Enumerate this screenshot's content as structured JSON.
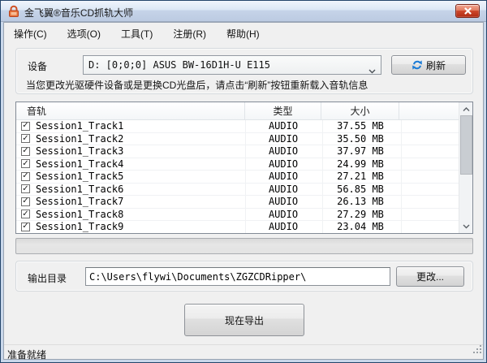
{
  "window": {
    "title": "金飞翼®音乐CD抓轨大师",
    "status_text": "准备就绪"
  },
  "menu": {
    "items": [
      "操作(C)",
      "选项(O)",
      "工具(T)",
      "注册(R)",
      "帮助(H)"
    ]
  },
  "device": {
    "label": "设备",
    "selected": "D:  [0;0;0] ASUS BW-16D1H-U E115",
    "refresh_label": "刷新",
    "hint": "当您更改光驱硬件设备或是更换CD光盘后，请点击“刷新”按钮重新载入音轨信息"
  },
  "tracks": {
    "columns": [
      "音轨",
      "类型",
      "大小"
    ],
    "rows": [
      {
        "checked": true,
        "name": "Session1_Track1",
        "type": "AUDIO",
        "size": "37.55 MB"
      },
      {
        "checked": true,
        "name": "Session1_Track2",
        "type": "AUDIO",
        "size": "35.50 MB"
      },
      {
        "checked": true,
        "name": "Session1_Track3",
        "type": "AUDIO",
        "size": "37.97 MB"
      },
      {
        "checked": true,
        "name": "Session1_Track4",
        "type": "AUDIO",
        "size": "24.99 MB"
      },
      {
        "checked": true,
        "name": "Session1_Track5",
        "type": "AUDIO",
        "size": "27.21 MB"
      },
      {
        "checked": true,
        "name": "Session1_Track6",
        "type": "AUDIO",
        "size": "56.85 MB"
      },
      {
        "checked": true,
        "name": "Session1_Track7",
        "type": "AUDIO",
        "size": "26.13 MB"
      },
      {
        "checked": true,
        "name": "Session1_Track8",
        "type": "AUDIO",
        "size": "27.29 MB"
      },
      {
        "checked": true,
        "name": "Session1_Track9",
        "type": "AUDIO",
        "size": "23.04 MB"
      }
    ]
  },
  "output": {
    "label": "输出目录",
    "path": "C:\\Users\\flywi\\Documents\\ZGZCDRipper\\",
    "change_label": "更改..."
  },
  "export_button": {
    "label": "现在导出"
  },
  "icons": {
    "check": "✓",
    "app_icon": "orange-lock",
    "refresh_icon": "blue-circular-arrows",
    "close_icon": "white-x"
  },
  "colors": {
    "frame_blue": "#24456b",
    "titlebar_top": "#f0f5fc",
    "titlebar_bottom": "#bccbe2",
    "client_bg": "#f0f0f0",
    "close_red": "#d04a2e",
    "refresh_blue": "#1c7cd6"
  }
}
